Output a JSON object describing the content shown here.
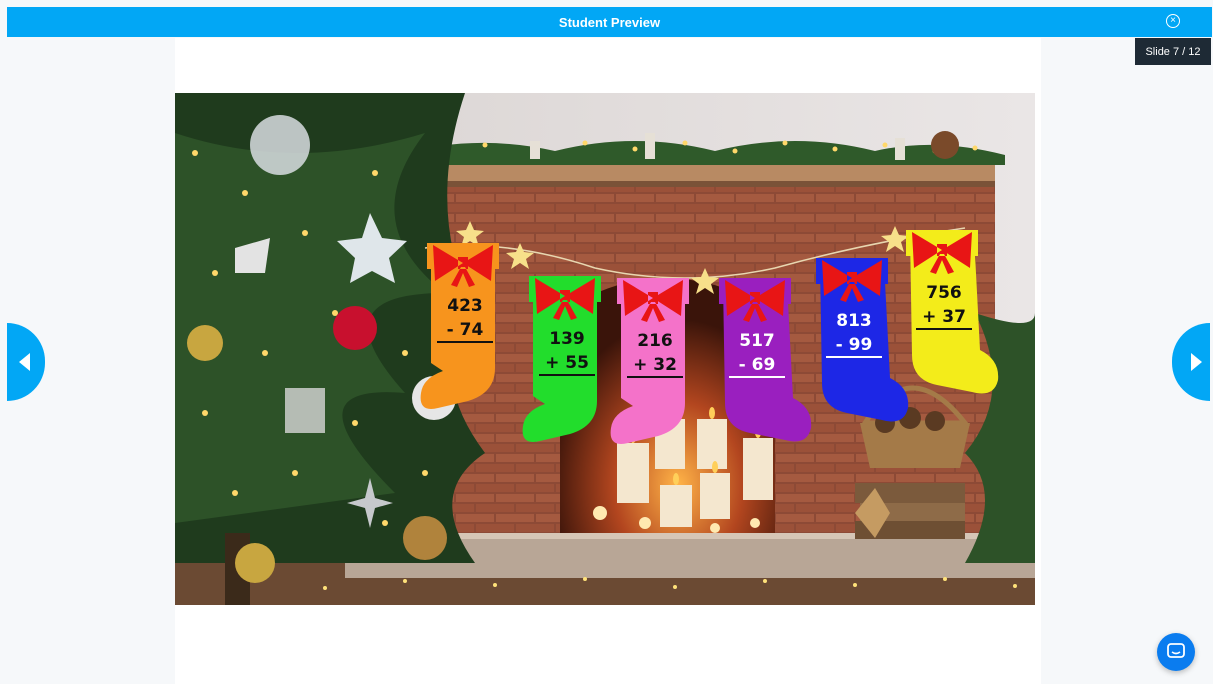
{
  "header": {
    "title": "Student Preview",
    "close_icon": "close-circle-icon"
  },
  "slide_counter": "Slide 7 / 12",
  "navigation": {
    "prev_icon": "chevron-left-icon",
    "next_icon": "chevron-right-icon"
  },
  "chat": {
    "icon": "chat-bubble-icon"
  },
  "slide": {
    "stockings": [
      {
        "top": "423",
        "op": "-",
        "bottom": "74",
        "color": "#f7941d"
      },
      {
        "top": "139",
        "op": "+",
        "bottom": "55",
        "color": "#22dd2c"
      },
      {
        "top": "216",
        "op": "+",
        "bottom": "32",
        "color": "#f472c9"
      },
      {
        "top": "517",
        "op": "-",
        "bottom": "69",
        "color": "#9a1fbf"
      },
      {
        "top": "813",
        "op": "-",
        "bottom": "99",
        "color": "#1d27e6"
      },
      {
        "top": "756",
        "op": "+",
        "bottom": "37",
        "color": "#f3ec1a"
      }
    ]
  },
  "colors": {
    "accent": "#02a7f5",
    "counter_bg": "#1e2a35",
    "chat": "#0a7cef",
    "bow": "#e81515"
  }
}
